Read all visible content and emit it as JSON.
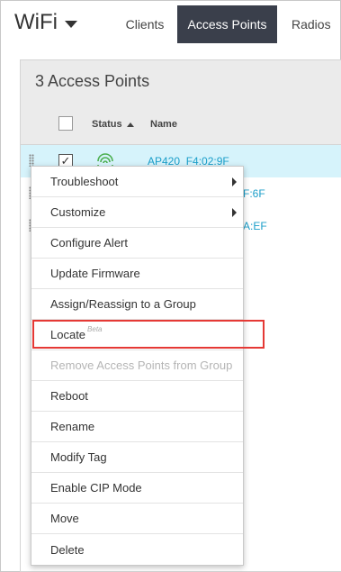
{
  "header": {
    "title": "WiFi",
    "tabs": [
      {
        "label": "Clients",
        "active": false
      },
      {
        "label": "Access Points",
        "active": true
      },
      {
        "label": "Radios",
        "active": false
      }
    ]
  },
  "panel": {
    "title": "3 Access Points",
    "columns": {
      "status": "Status",
      "name": "Name"
    },
    "rows": [
      {
        "name": "AP420_F4:02:9F",
        "checked": true
      },
      {
        "name_suffix": "F:6F",
        "checked": false
      },
      {
        "name_suffix": "A:EF",
        "checked": false
      }
    ]
  },
  "menu": {
    "items": [
      {
        "label": "Troubleshoot",
        "submenu": true
      },
      {
        "label": "Customize",
        "submenu": true
      },
      {
        "label": "Configure Alert"
      },
      {
        "label": "Update Firmware"
      },
      {
        "label": "Assign/Reassign to a Group"
      },
      {
        "label": "Locate",
        "badge": "Beta",
        "highlighted": true
      },
      {
        "label": "Remove Access Points from Group",
        "disabled": true
      },
      {
        "label": "Reboot"
      },
      {
        "label": "Rename"
      },
      {
        "label": "Modify Tag"
      },
      {
        "label": "Enable CIP Mode"
      },
      {
        "label": "Move"
      },
      {
        "label": "Delete"
      }
    ]
  },
  "colors": {
    "active_tab_bg": "#3a3f4b",
    "link": "#1a9ec9",
    "signal_green": "#4caf50",
    "selected_row_bg": "#d6f3fb",
    "highlight_border": "#e53935"
  },
  "icons": {
    "dropdown": "caret-down-icon",
    "sort": "sort-ascending-icon",
    "status": "wifi-signal-icon",
    "submenu": "chevron-right-icon"
  }
}
